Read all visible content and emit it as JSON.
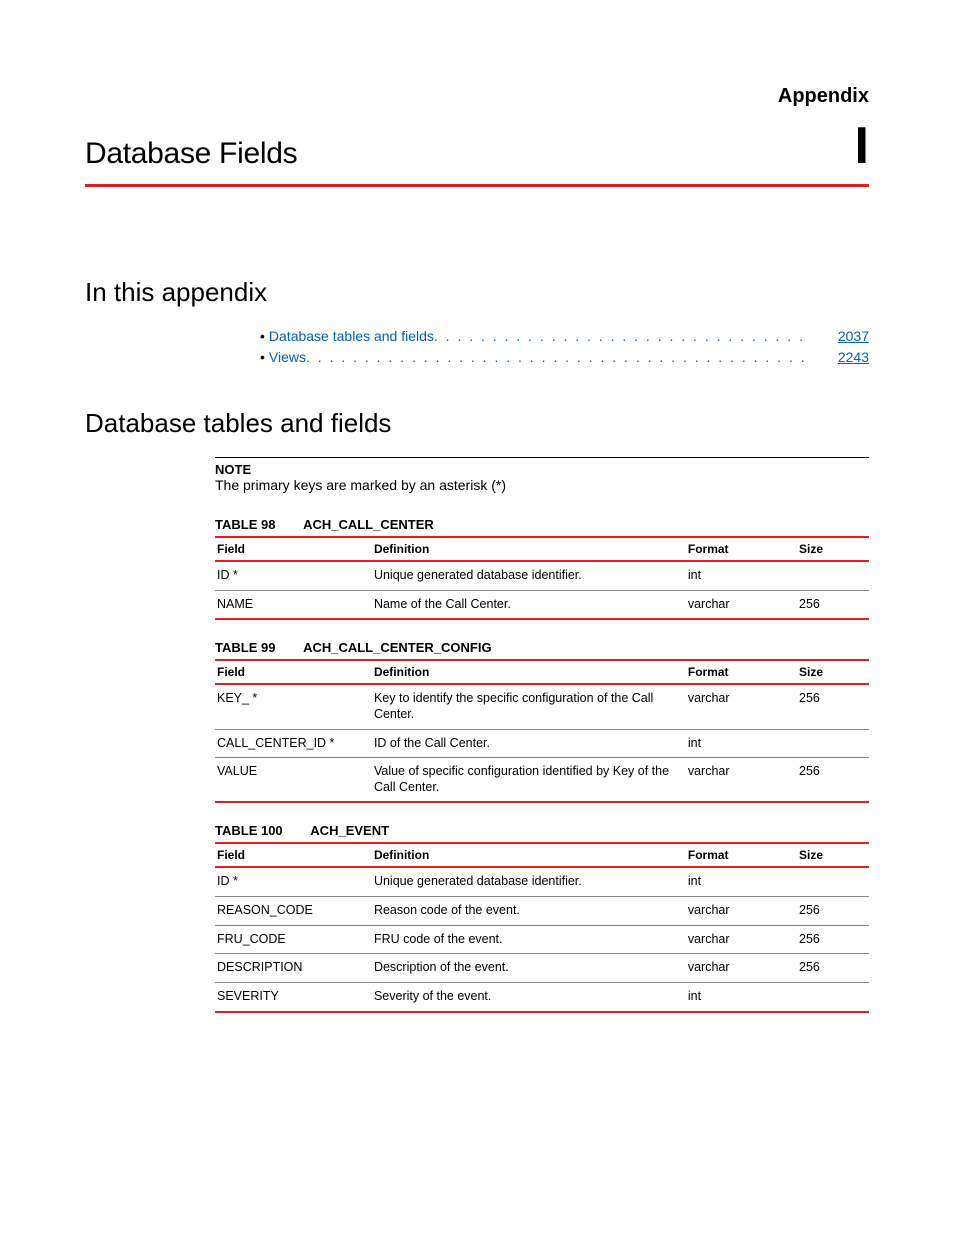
{
  "header": {
    "appendix_label": "Appendix",
    "page_title": "Database Fields",
    "appendix_letter": "I"
  },
  "section1_title": "In this appendix",
  "toc": [
    {
      "label": "Database tables and fields",
      "page": "2037"
    },
    {
      "label": "Views",
      "page": "2243"
    }
  ],
  "section2_title": "Database tables and fields",
  "note_label": "NOTE",
  "note_text": "The primary keys are marked by an asterisk (*)",
  "col_headers": {
    "field": "Field",
    "definition": "Definition",
    "format": "Format",
    "size": "Size"
  },
  "tables": [
    {
      "caption_prefix": "TABLE 98",
      "caption_name": "ACH_CALL_CENTER",
      "rows": [
        {
          "field": "ID *",
          "definition": "Unique generated database identifier.",
          "format": "int",
          "size": ""
        },
        {
          "field": "NAME",
          "definition": "Name of the Call Center.",
          "format": "varchar",
          "size": "256"
        }
      ]
    },
    {
      "caption_prefix": "TABLE 99",
      "caption_name": "ACH_CALL_CENTER_CONFIG",
      "rows": [
        {
          "field": "KEY_ *",
          "definition": "Key to identify the specific configuration of the Call Center.",
          "format": "varchar",
          "size": "256"
        },
        {
          "field": "CALL_CENTER_ID *",
          "definition": "ID of the Call Center.",
          "format": "int",
          "size": ""
        },
        {
          "field": "VALUE",
          "definition": "Value of specific configuration identified by Key of the Call Center.",
          "format": "varchar",
          "size": "256"
        }
      ]
    },
    {
      "caption_prefix": "TABLE 100",
      "caption_name": "ACH_EVENT",
      "rows": [
        {
          "field": "ID *",
          "definition": "Unique generated database identifier.",
          "format": "int",
          "size": ""
        },
        {
          "field": "REASON_CODE",
          "definition": "Reason code of the event.",
          "format": "varchar",
          "size": "256"
        },
        {
          "field": "FRU_CODE",
          "definition": "FRU code of the event.",
          "format": "varchar",
          "size": "256"
        },
        {
          "field": "DESCRIPTION",
          "definition": "Description of the event.",
          "format": "varchar",
          "size": "256"
        },
        {
          "field": "SEVERITY",
          "definition": "Severity of the event.",
          "format": "int",
          "size": ""
        }
      ]
    }
  ],
  "dots": ". . . . . . . . . . . . . . . . . . . . . . . . . . . . . . . . . . . . . . . . . . . . . . . . . . . . . . . . . . . . . . . . . . . . . . . . . . . . . . . . . . . . . . . . . . . . . . . . ."
}
